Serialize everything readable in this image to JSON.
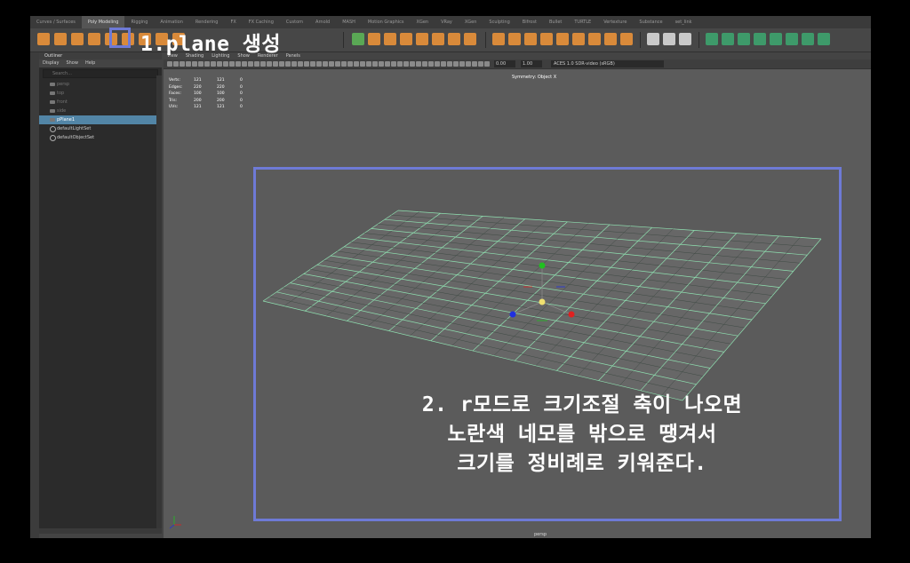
{
  "shelf": {
    "tabs": [
      "Curves / Surfaces",
      "Poly Modeling",
      "Rigging",
      "Animation",
      "Rendering",
      "FX",
      "FX Caching",
      "Custom",
      "Arnold",
      "MASH",
      "Motion Graphics",
      "XGen",
      "VRay",
      "XGen",
      "Sculpting",
      "Bifrost",
      "Bullet",
      "TURTLE",
      "Vertexture",
      "Substance",
      "set_link"
    ],
    "active_tab": "Poly Modeling"
  },
  "outliner": {
    "title": "Outliner",
    "menu": [
      "Display",
      "Show",
      "Help"
    ],
    "search_placeholder": "Search...",
    "items": [
      {
        "label": "persp",
        "kind": "camera",
        "state": "dim"
      },
      {
        "label": "top",
        "kind": "camera",
        "state": "dim"
      },
      {
        "label": "front",
        "kind": "camera",
        "state": "dim"
      },
      {
        "label": "side",
        "kind": "camera",
        "state": "dim"
      },
      {
        "label": "pPlane1",
        "kind": "mesh",
        "state": "selected"
      },
      {
        "label": "defaultLightSet",
        "kind": "set",
        "state": "normal"
      },
      {
        "label": "defaultObjectSet",
        "kind": "set",
        "state": "normal"
      }
    ]
  },
  "viewport": {
    "menu": [
      "View",
      "Shading",
      "Lighting",
      "Show",
      "Renderer",
      "Panels"
    ],
    "exposure": "0.00",
    "gamma": "1.00",
    "color_space": "ACES 1.0 SDR-video (sRGB)",
    "symmetry": "Symmetry: Object X",
    "camera_label": "persp",
    "hud": [
      {
        "label": "Verts:",
        "v1": "121",
        "v2": "121",
        "v3": "0"
      },
      {
        "label": "Edges:",
        "v1": "220",
        "v2": "220",
        "v3": "0"
      },
      {
        "label": "Faces:",
        "v1": "100",
        "v2": "100",
        "v3": "0"
      },
      {
        "label": "Tris:",
        "v1": "200",
        "v2": "200",
        "v3": "0"
      },
      {
        "label": "UVs:",
        "v1": "121",
        "v2": "121",
        "v3": "0"
      }
    ]
  },
  "annotations": {
    "step1": "1.plane 생성",
    "step2_lines": [
      "2. r모드로 크기조절 축이 나오면",
      "노란색 네모를 밖으로 땡겨서",
      "크기를 정비례로 키워준다."
    ],
    "highlight_color": "#6e7ad6"
  },
  "colors": {
    "grid": "#8fe0b0",
    "plane": "#676767",
    "selection": "#5285a6",
    "axis_x": "#e02020",
    "axis_y": "#20c020",
    "axis_z": "#2030e0",
    "center_handle": "#f0e070"
  }
}
